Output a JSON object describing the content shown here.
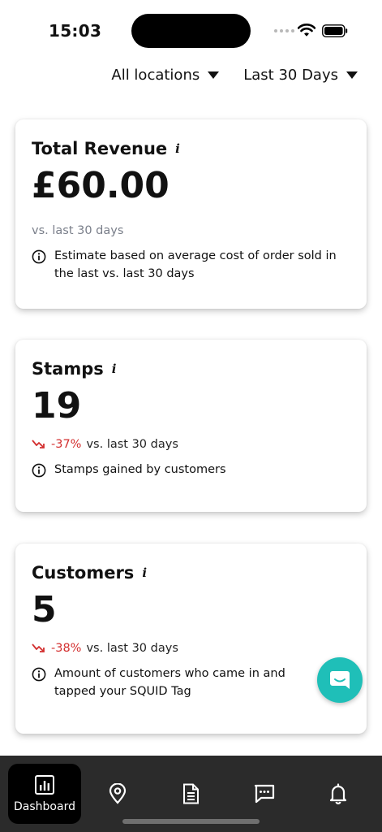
{
  "status_bar": {
    "time": "15:03"
  },
  "filters": {
    "location": "All locations",
    "period": "Last 30 Days"
  },
  "cards": [
    {
      "title": "Total Revenue",
      "info_glyph": "i",
      "value": "£60.00",
      "comparison": "vs. last 30 days",
      "note": "Estimate based on average cost of order sold in the last vs. last 30 days"
    },
    {
      "title": "Stamps",
      "info_glyph": "i",
      "value": "19",
      "delta": "-37%",
      "comparison": "vs. last 30 days",
      "note": "Stamps gained by customers"
    },
    {
      "title": "Customers",
      "info_glyph": "i",
      "value": "5",
      "delta": "-38%",
      "comparison": "vs. last 30 days",
      "note": "Amount of customers who came in and tapped your SQUID Tag"
    }
  ],
  "bottom_nav": {
    "active_label": "Dashboard",
    "icons": [
      "bar-chart-icon",
      "location-pin-icon",
      "document-icon",
      "message-icon",
      "bell-icon"
    ]
  },
  "colors": {
    "negative_delta": "#d32f2f",
    "chat_fab": "#1fbfb8",
    "nav_background": "#2b2b2b",
    "muted_text": "#7a7f8a"
  }
}
